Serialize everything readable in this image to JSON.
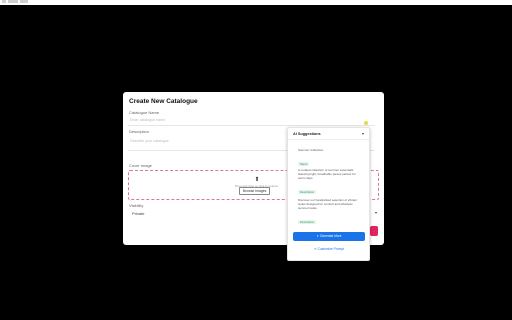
{
  "modal": {
    "title": "Create New Catalogue",
    "name_label": "Catalogue Name",
    "name_placeholder": "Enter catalogue name",
    "description_label": "Description",
    "description_placeholder": "Describe your catalogue",
    "cover_label": "Cover Image",
    "upload_text": "Drag and drop or click to upload",
    "browse_label": "Browse Images",
    "visibility_label": "Visibility",
    "visibility_value": "Private"
  },
  "ai_panel": {
    "title": "AI Suggestions",
    "suggestions": [
      {
        "text": "Summer Collection",
        "badge": "Name"
      },
      {
        "text": "A curated collection of summer essentials featuring light, breathable pieces perfect for warm days.",
        "badge": "Description"
      },
      {
        "text": "Discover our handpicked selection of vibrant styles designed for comfort and effortless summer looks.",
        "badge": "Description"
      }
    ],
    "primary_button": "Generate More",
    "secondary_button": "Customize Prompt"
  },
  "icons": {
    "upload": "upload-icon",
    "sparkle": "sparkle-icon",
    "chevron": "chevron-down-icon"
  },
  "colors": {
    "primary": "#1a73e8",
    "accent": "#e0245e",
    "badge_bg": "#e4f6ea",
    "badge_text": "#3c8f58"
  }
}
